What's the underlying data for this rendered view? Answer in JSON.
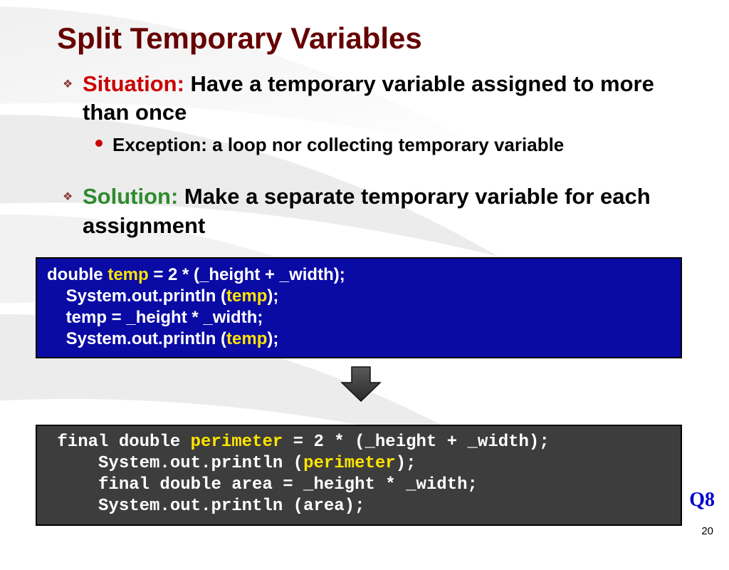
{
  "title": "Split Temporary Variables",
  "situation": {
    "label": "Situation:",
    "text": " Have a temporary variable assigned to more than once",
    "exception": "Exception: a loop nor collecting temporary variable"
  },
  "solution": {
    "label": "Solution:",
    "text": " Make a separate temporary variable for each assignment"
  },
  "code_before": {
    "l1a": "double ",
    "l1b": "temp",
    "l1c": " = 2 * (_height + _width);",
    "l2a": "    System.out.println (",
    "l2b": "temp",
    "l2c": ");",
    "l3": "    temp = _height * _width;",
    "l4a": "    System.out.println (",
    "l4b": "temp",
    "l4c": ");"
  },
  "code_after": {
    "l1a": " final double ",
    "l1b": "perimeter",
    "l1c": " = 2 * (_height + _width);",
    "l2a": "     System.out.println (",
    "l2b": "perimeter",
    "l2c": ");",
    "l3": "     final double area = _height * _width;",
    "l4": "     System.out.println (area);"
  },
  "q_label": "Q8",
  "page_num": "20"
}
